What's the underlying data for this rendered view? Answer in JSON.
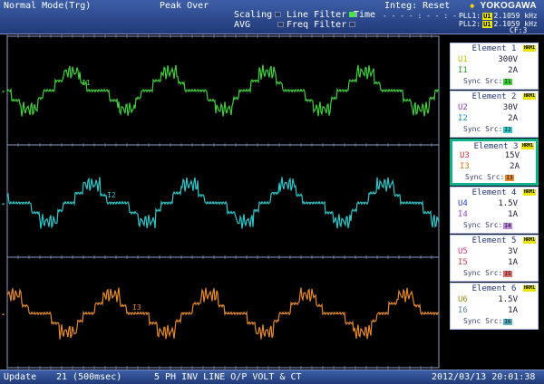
{
  "header": {
    "mode": "Normal Mode(Trg)",
    "peak_over": "Peak Over",
    "scaling": "Scaling",
    "avg": "AVG",
    "line_filter": "Line Filter",
    "freq_filter": "Freq Filter",
    "time": "Time",
    "integ": "Integ: Reset",
    "integ_time": "- - - - : - - : - -",
    "brand": "YOKOGAWA",
    "pll1_label": "PLL1:",
    "pll1_tag": "U1",
    "pll1_freq": "2.1059 kHz",
    "pll2_label": "PLL2:",
    "pll2_tag": "U1",
    "pll2_freq": "2.1059 kHz",
    "cf": "CF:3"
  },
  "display": {
    "traces": [
      {
        "label": "I1",
        "color": "#3ecf3a"
      },
      {
        "label": "I2",
        "color": "#2ec7c9"
      },
      {
        "label": "I3",
        "color": "#e5892a"
      }
    ],
    "grid_color": "#8aa0c8"
  },
  "elements": [
    {
      "title": "Element 1",
      "hrm": "HRM1",
      "u_name": "U1",
      "u_range": "300V",
      "i_name": "I1",
      "i_range": "2A",
      "sync": "Sync Src:",
      "sync_tag": "I1",
      "u_color": "#c7bf12",
      "i_color": "#2a9a2a",
      "sync_color": "#3ecf3a",
      "selected": false
    },
    {
      "title": "Element 2",
      "hrm": "HRM1",
      "u_name": "U2",
      "u_range": "30V",
      "i_name": "I2",
      "i_range": "2A",
      "sync": "Sync Src:",
      "sync_tag": "I2",
      "u_color": "#8a3ac0",
      "i_color": "#1a9aa8",
      "sync_color": "#2ec7c9",
      "selected": false
    },
    {
      "title": "Element 3",
      "hrm": "HRM1",
      "u_name": "U3",
      "u_range": "15V",
      "i_name": "I3",
      "i_range": "2A",
      "sync": "Sync Src:",
      "sync_tag": "I3",
      "u_color": "#d83030",
      "i_color": "#d97a1a",
      "sync_color": "#e5892a",
      "selected": true
    },
    {
      "title": "Element 4",
      "hrm": "HRM1",
      "u_name": "U4",
      "u_range": "1.5V",
      "i_name": "I4",
      "i_range": "1A",
      "sync": "Sync Src:",
      "sync_tag": "I4",
      "u_color": "#2a3ac8",
      "i_color": "#9a4ad0",
      "sync_color": "#b98ae0",
      "selected": false
    },
    {
      "title": "Element 5",
      "hrm": "HRM1",
      "u_name": "U5",
      "u_range": "3V",
      "i_name": "I5",
      "i_range": "1A",
      "sync": "Sync Src:",
      "sync_tag": "I5",
      "u_color": "#d83a8a",
      "i_color": "#c84a4a",
      "sync_color": "#e06a6a",
      "selected": false
    },
    {
      "title": "Element 6",
      "hrm": "HRM1",
      "u_name": "U6",
      "u_range": "1.5V",
      "i_name": "I6",
      "i_range": "1A",
      "sync": "Sync Src:",
      "sync_tag": "I6",
      "u_color": "#9a8a1a",
      "i_color": "#5a8a9a",
      "sync_color": "#58b0c8",
      "selected": false
    }
  ],
  "footer": {
    "update": "Update",
    "count": "21 (500msec)",
    "caption": "5 PH INV LINE O/P VOLT & CT",
    "datetime": "2012/03/13  20:01:38"
  }
}
